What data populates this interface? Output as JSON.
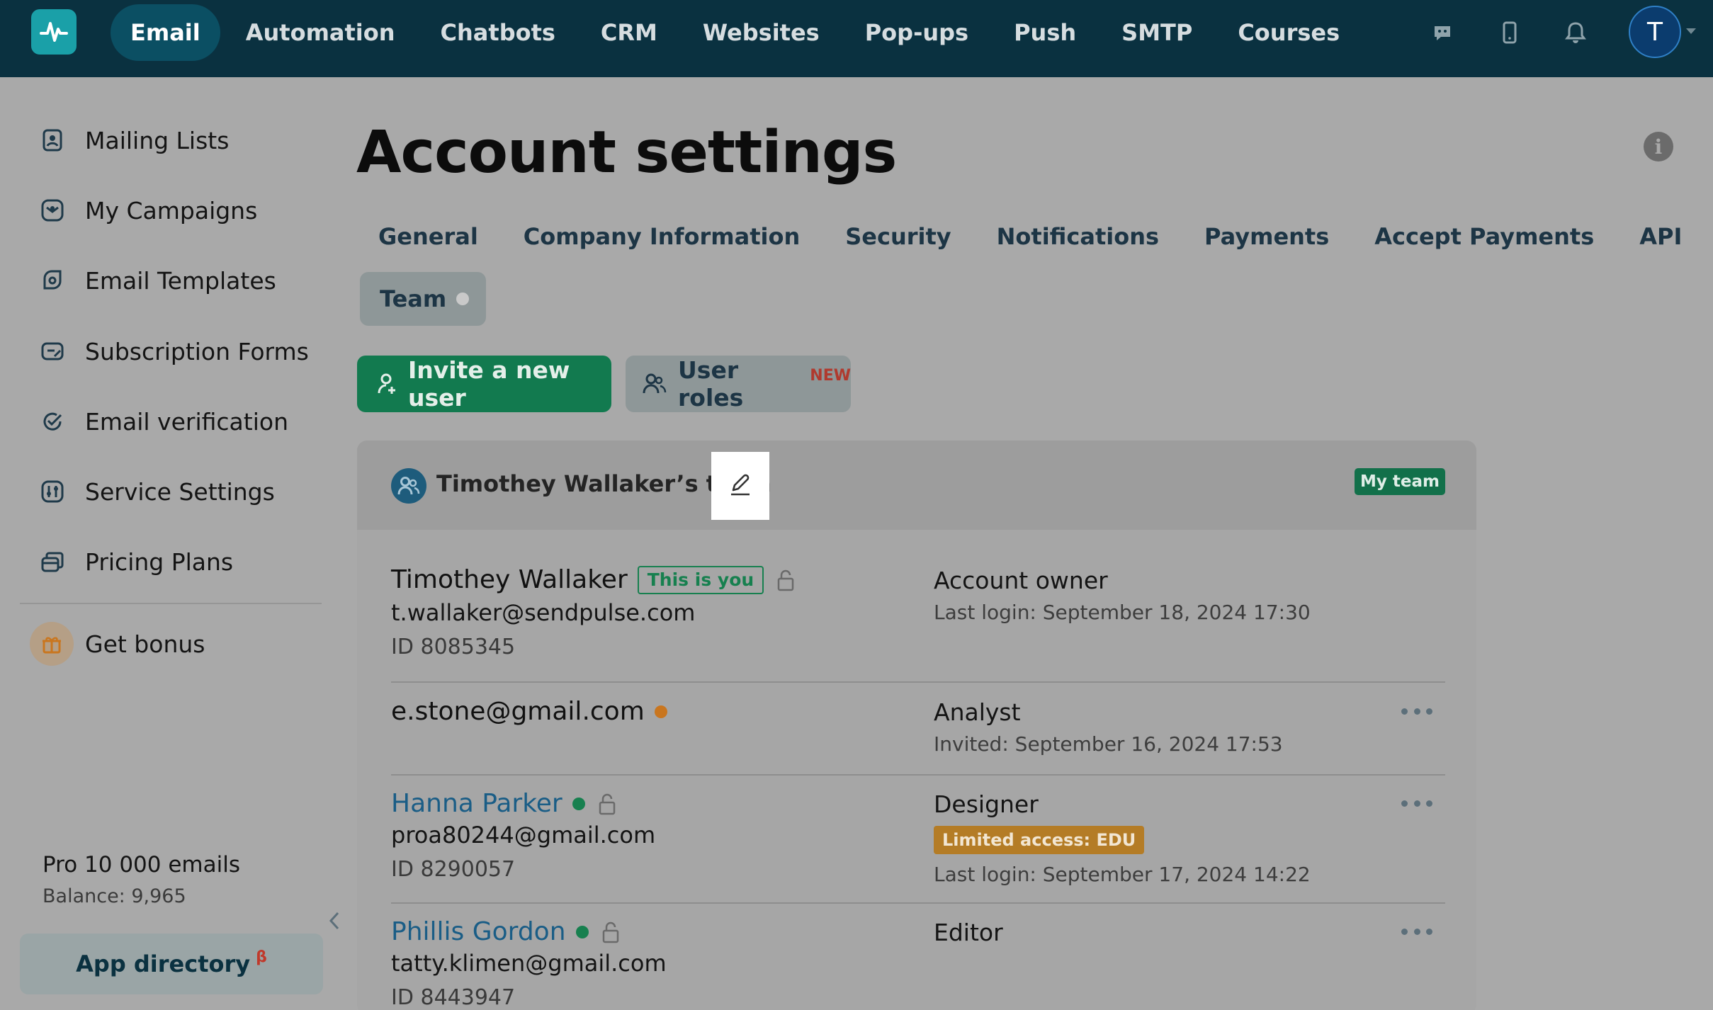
{
  "topbar": {
    "nav": [
      "Email",
      "Automation",
      "Chatbots",
      "CRM",
      "Websites",
      "Pop-ups",
      "Push",
      "SMTP",
      "Courses"
    ],
    "active": "Email",
    "avatar_initial": "T",
    "icons": [
      "pulse-logo-icon",
      "chat-icon",
      "mobile-icon",
      "bell-icon"
    ]
  },
  "sidebar": {
    "items": [
      {
        "label": "Mailing Lists",
        "icon": "contact-book-icon"
      },
      {
        "label": "My Campaigns",
        "icon": "campaign-icon"
      },
      {
        "label": "Email Templates",
        "icon": "template-icon"
      },
      {
        "label": "Subscription Forms",
        "icon": "form-icon"
      },
      {
        "label": "Email verification",
        "icon": "check-circle-icon"
      },
      {
        "label": "Service Settings",
        "icon": "sliders-icon"
      },
      {
        "label": "Pricing Plans",
        "icon": "cards-icon"
      }
    ],
    "bonus": "Get bonus",
    "plan": "Pro 10 000 emails",
    "balance": "Balance: 9,965",
    "app_directory": "App directory",
    "app_directory_sup": "β"
  },
  "main": {
    "title": "Account settings",
    "tabs": [
      "General",
      "Company Information",
      "Security",
      "Notifications",
      "Payments",
      "Accept Payments",
      "API"
    ],
    "team_tab": "Team",
    "invite_button": "Invite a new user",
    "roles_button": "User roles",
    "roles_new": "NEW"
  },
  "team": {
    "name": "Timothey Wallaker’s team",
    "badge": "My team",
    "members": [
      {
        "name": "Timothey Wallaker",
        "you": "This is you",
        "email": "t.wallaker@sendpulse.com",
        "id": "ID 8085345",
        "role": "Account owner",
        "meta": "Last login: September 18, 2024 17:30"
      },
      {
        "name": "e.stone@gmail.com",
        "role": "Analyst",
        "meta": "Invited: September 16, 2024 17:53"
      },
      {
        "name": "Hanna Parker",
        "email": "proa80244@gmail.com",
        "id": "ID 8290057",
        "role": "Designer",
        "limited": "Limited access: EDU",
        "meta": "Last login: September 17, 2024 14:22"
      },
      {
        "name": "Phillis Gordon",
        "email": "tatty.klimen@gmail.com",
        "id": "ID 8443947",
        "role": "Editor"
      }
    ]
  },
  "colors": {
    "topbar": "#0a3140",
    "accent_green": "#127a4f",
    "link_blue": "#1a5d86",
    "pending_orange": "#c9761f",
    "online_green": "#17804f",
    "limited_badge": "#b47c26"
  }
}
